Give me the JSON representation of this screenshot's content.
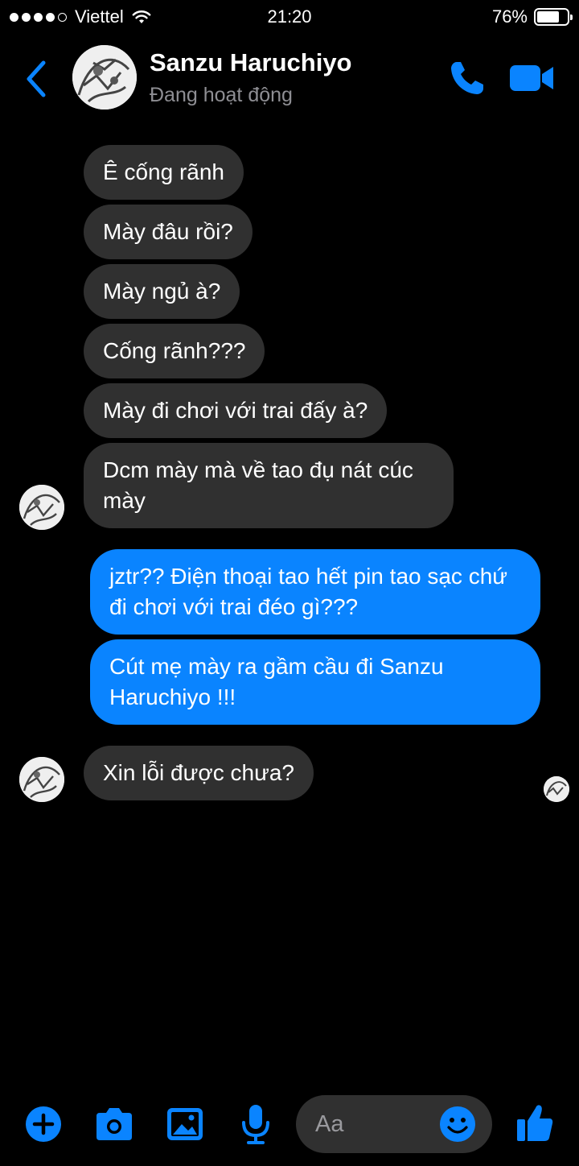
{
  "status_bar": {
    "carrier": "Viettel",
    "time": "21:20",
    "battery": "76%",
    "battery_level": 0.76,
    "signal_bars": 4,
    "signal_total": 5
  },
  "header": {
    "name": "Sanzu Haruchiyo",
    "status": "Đang hoạt động"
  },
  "accent_color": "#0a84ff",
  "messages": [
    {
      "from": "them",
      "text": "Ê cống rãnh"
    },
    {
      "from": "them",
      "text": "Mày đâu rồi?"
    },
    {
      "from": "them",
      "text": "Mày ngủ à?"
    },
    {
      "from": "them",
      "text": "Cống rãnh???"
    },
    {
      "from": "them",
      "text": "Mày đi chơi với trai đấy à?"
    },
    {
      "from": "them",
      "text": "Dcm mày mà về tao đụ nát cúc mày"
    },
    {
      "from": "me",
      "text": "jztr?? Điện thoại tao hết pin tao sạc chứ đi chơi với trai đéo gì???"
    },
    {
      "from": "me",
      "text": "Cút mẹ mày ra gầm cầu đi Sanzu Haruchiyo !!!"
    },
    {
      "from": "them",
      "text": "Xin lỗi được chưa?"
    }
  ],
  "composer": {
    "placeholder": "Aa",
    "icons": [
      "plus-icon",
      "camera-icon",
      "photo-icon",
      "microphone-icon",
      "emoji-icon",
      "thumbs-up-icon"
    ]
  }
}
